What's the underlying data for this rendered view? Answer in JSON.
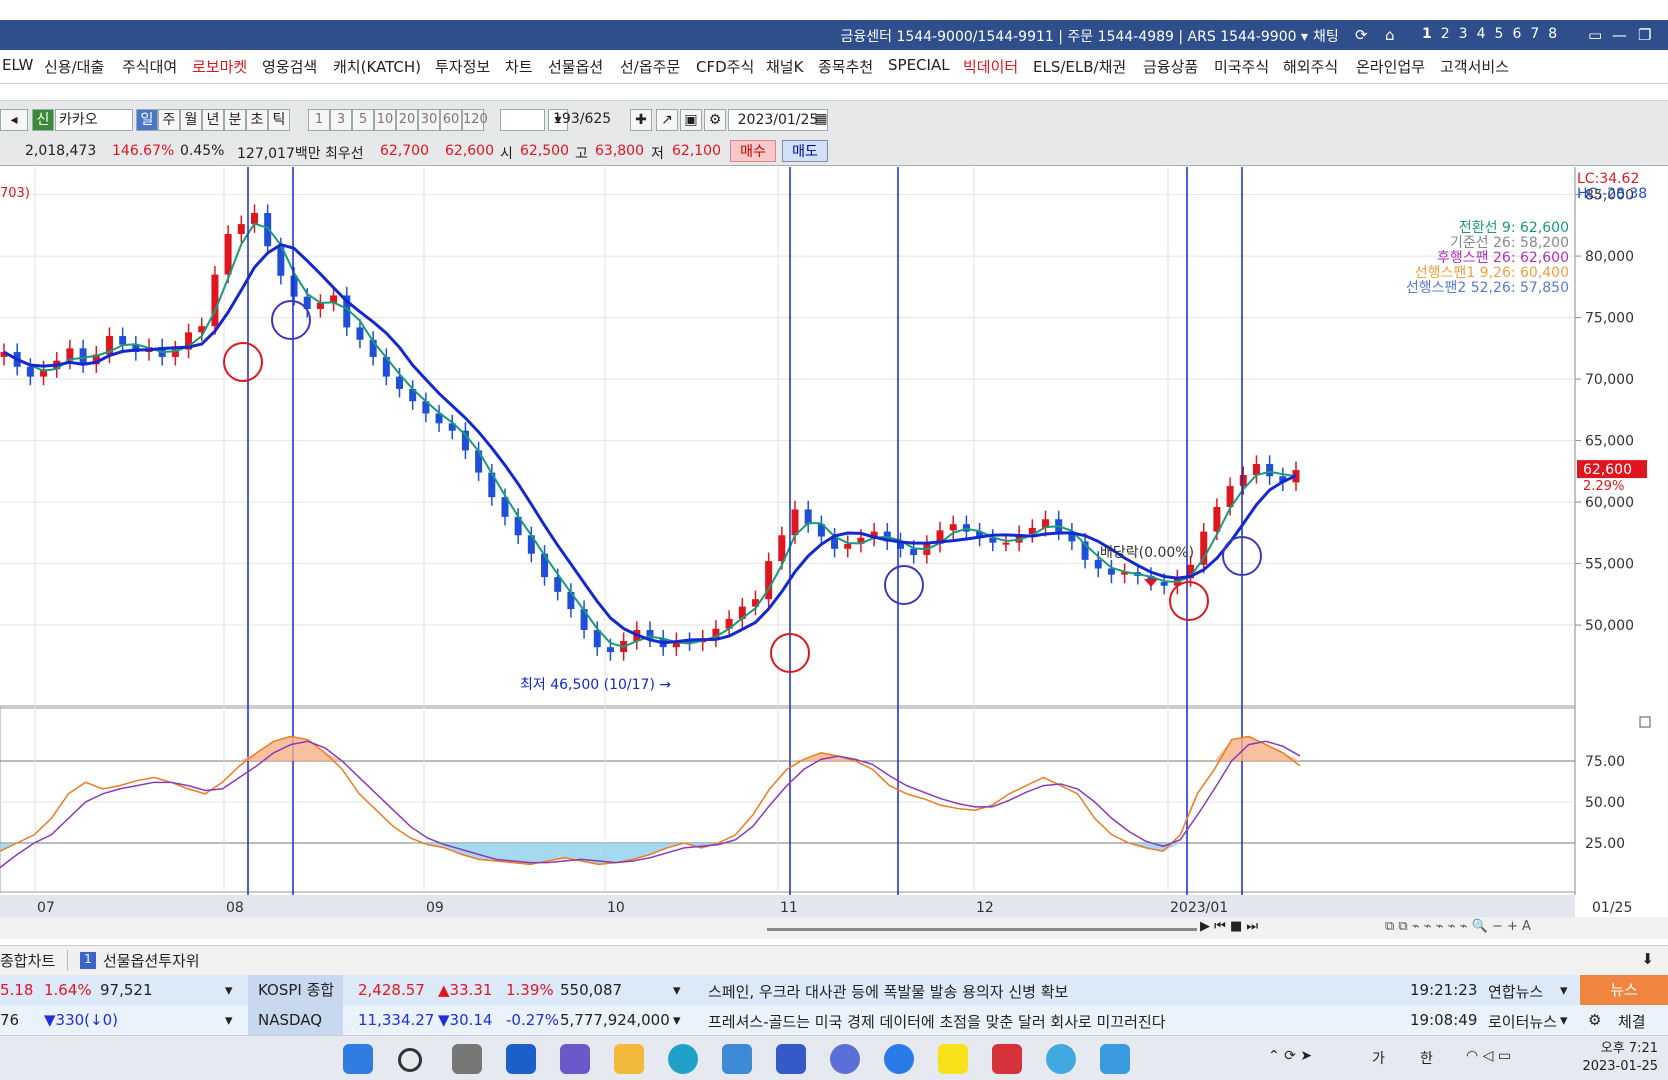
{
  "titlebar": {
    "info": "금융센터 1544-9000/1544-9911 | 주문 1544-4989 | ARS 1544-9900 ▾",
    "chat": "채팅",
    "pages": [
      "1",
      "2",
      "3",
      "4",
      "5",
      "6",
      "7",
      "8"
    ]
  },
  "menu": [
    {
      "label": "ELW",
      "red": false
    },
    {
      "label": "신용/대출",
      "red": false
    },
    {
      "label": "주식대여",
      "red": false
    },
    {
      "label": "로보마켓",
      "red": true
    },
    {
      "label": "영웅검색",
      "red": false
    },
    {
      "label": "캐치(KATCH)",
      "red": false
    },
    {
      "label": "투자정보",
      "red": false
    },
    {
      "label": "차트",
      "red": false
    },
    {
      "label": "선물옵션",
      "red": false
    },
    {
      "label": "선/옵주문",
      "red": false
    },
    {
      "label": "CFD주식",
      "red": false
    },
    {
      "label": "채널K",
      "red": false
    },
    {
      "label": "종목추천",
      "red": false
    },
    {
      "label": "SPECIAL",
      "red": false
    },
    {
      "label": "빅데이터",
      "red": true
    },
    {
      "label": "ELS/ELB/채권",
      "red": false
    },
    {
      "label": "금융상품",
      "red": false
    },
    {
      "label": "미국주식",
      "red": false
    },
    {
      "label": "해외주식",
      "red": false
    },
    {
      "label": "온라인업무",
      "red": false
    },
    {
      "label": "고객서비스",
      "red": false
    }
  ],
  "toolbar": {
    "credit_badge": "신",
    "stock_name": "카카오",
    "periods": [
      "일",
      "주",
      "월",
      "년",
      "분",
      "초",
      "틱"
    ],
    "intervals": [
      "1",
      "3",
      "5",
      "10",
      "20",
      "30",
      "60",
      "120"
    ],
    "count": "193",
    "total": "/625",
    "date": "2023/01/25"
  },
  "quote": {
    "volume": "2,018,473",
    "vol_ratio": "146.67%",
    "turnover": "0.45%",
    "amount": "127,017백만",
    "best_label": "최우선",
    "best_ask": "62,700",
    "best_bid": "62,600",
    "open_label": "시",
    "open": "62,500",
    "high_label": "고",
    "high": "63,800",
    "low_label": "저",
    "low": "62,100",
    "buy": "매수",
    "sell": "매도"
  },
  "chart_data": {
    "type": "candlestick",
    "left_label": "703)",
    "corner_lc": "LC:34.62",
    "corner_hc": "HC:-28.38",
    "legend": [
      {
        "text": "전환선 9: 62,600",
        "color": "#1a9a7a"
      },
      {
        "text": "기준선 26: 58,200",
        "color": "#888888"
      },
      {
        "text": "후행스팬 26: 62,600",
        "color": "#b030c0"
      },
      {
        "text": "선행스팬1 9,26: 60,400",
        "color": "#f0a040"
      },
      {
        "text": "선행스팬2 52,26: 57,850",
        "color": "#5a7ad0"
      }
    ],
    "price_axis": {
      "ticks": [
        "85,000",
        "80,000",
        "75,000",
        "70,000",
        "65,000",
        "60,000",
        "55,000",
        "50,000"
      ],
      "values": [
        85000,
        80000,
        75000,
        70000,
        65000,
        60000,
        55000,
        50000
      ],
      "ylim": [
        43500,
        87000
      ]
    },
    "current_price": "62,600",
    "current_change": "2.29%",
    "annotation_low": "최저 46,500 (10/17) →",
    "annotation_dividend": "배당락(0.00%)",
    "osc_axis": {
      "ticks": [
        "75.00",
        "50.00",
        "25.00"
      ],
      "values": [
        75,
        50,
        25
      ],
      "ylim": [
        0,
        100
      ]
    },
    "x_labels": [
      "07",
      "08",
      "09",
      "10",
      "11",
      "12",
      "2023/01",
      "01/25"
    ],
    "closes": [
      72200,
      71000,
      70200,
      70800,
      71500,
      72500,
      71200,
      72000,
      73500,
      72800,
      72200,
      72600,
      71800,
      72400,
      73800,
      74300,
      78500,
      81800,
      82600,
      83500,
      80800,
      78400,
      76700,
      75700,
      76200,
      76800,
      74200,
      73200,
      71800,
      70200,
      69200,
      68200,
      67200,
      66400,
      65800,
      64200,
      62400,
      60400,
      58800,
      57300,
      55800,
      53900,
      52700,
      51300,
      49600,
      48200,
      47800,
      48700,
      49600,
      48900,
      48200,
      48700,
      48600,
      48900,
      49700,
      50500,
      51500,
      52100,
      55200,
      57300,
      59400,
      58200,
      57200,
      56200,
      56600,
      57100,
      57600,
      56800,
      56200,
      55700,
      56600,
      57700,
      58200,
      57600,
      57100,
      56700,
      56700,
      57400,
      57900,
      58600,
      57600,
      56800,
      55300,
      54600,
      54100,
      54300,
      54000,
      53500,
      53200,
      53800,
      54900,
      57600,
      59600,
      61300,
      62200,
      63100,
      62100,
      61600,
      62600
    ],
    "osc_k": [
      20,
      25,
      30,
      40,
      55,
      62,
      58,
      60,
      63,
      65,
      62,
      58,
      55,
      62,
      72,
      80,
      87,
      90,
      88,
      80,
      70,
      55,
      45,
      35,
      28,
      24,
      22,
      18,
      15,
      14,
      13,
      12,
      14,
      16,
      14,
      12,
      13,
      15,
      18,
      22,
      25,
      22,
      25,
      30,
      42,
      58,
      70,
      76,
      80,
      78,
      75,
      70,
      60,
      55,
      52,
      48,
      46,
      45,
      48,
      55,
      60,
      65,
      60,
      55,
      40,
      30,
      25,
      22,
      20,
      30,
      55,
      70,
      88,
      90,
      85,
      80,
      72
    ],
    "osc_d": [
      10,
      18,
      25,
      30,
      40,
      50,
      55,
      58,
      60,
      62,
      62,
      60,
      57,
      58,
      65,
      72,
      80,
      85,
      87,
      83,
      75,
      65,
      55,
      45,
      35,
      28,
      24,
      21,
      18,
      15,
      14,
      13,
      13,
      14,
      15,
      14,
      13,
      14,
      16,
      19,
      22,
      23,
      24,
      27,
      35,
      48,
      60,
      70,
      76,
      78,
      76,
      73,
      66,
      60,
      56,
      52,
      49,
      47,
      47,
      51,
      56,
      60,
      61,
      58,
      50,
      40,
      32,
      26,
      23,
      27,
      42,
      58,
      75,
      85,
      87,
      84,
      78
    ]
  },
  "tabs": {
    "main": "종합차트",
    "sub_badge": "1",
    "sub": "선물옵션투자위"
  },
  "tickers": [
    {
      "a": "5.18",
      "b": "1.64%",
      "c": "97,521",
      "idx": "KOSPI 종합",
      "val": "2,428.57",
      "chg": "▲33.31",
      "pct": "1.39%",
      "vol": "550,087",
      "news": "스페인, 우크라 대사관 등에 폭발물 발송 용의자 신병 확보",
      "time": "19:21:23",
      "src": "연합뉴스"
    },
    {
      "a": "76",
      "b": "▼330(↓0)",
      "c": "",
      "idx": "NASDAQ",
      "val": "11,334.27",
      "chg": "▼30.14",
      "pct": "-0.27%",
      "vol": "5,777,924,000",
      "news": "프레셔스-골드는 미국 경제 데이터에 초점을 맞춘 달러 회사로 미끄러진다",
      "time": "19:08:49",
      "src": "로이터뉴스"
    }
  ],
  "news_button": "뉴스",
  "settle": "체결",
  "taskbar": {
    "ime1": "가",
    "ime2": "한",
    "time": "오후 7:21",
    "date": "2023-01-25"
  }
}
